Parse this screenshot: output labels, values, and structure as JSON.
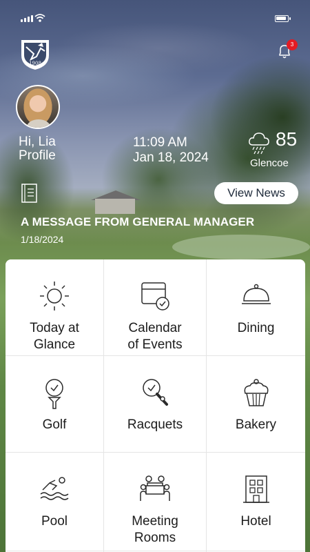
{
  "status_bar": {
    "signal_icon": "signal-icon",
    "wifi_icon": "wifi-icon",
    "battery_icon": "battery-icon"
  },
  "header": {
    "club_logo": {
      "year": "1908",
      "icon": "shield-logo-icon"
    },
    "notifications": {
      "icon": "bell-icon",
      "count": "3"
    }
  },
  "user": {
    "greeting": "Hi, Lia",
    "profile_link": "Profile"
  },
  "clock": {
    "time": "11:09 AM",
    "date": "Jan 18, 2024"
  },
  "weather": {
    "icon": "rain-cloud-icon",
    "temperature": "85",
    "location": "Glencoe"
  },
  "news": {
    "doc_icon": "document-icon",
    "button_label": "View News",
    "headline": "A MESSAGE FROM GENERAL MANAGER",
    "date": "1/18/2024"
  },
  "tiles": [
    {
      "line1": "Today at",
      "line2": "Glance",
      "icon": "sun-icon"
    },
    {
      "line1": "Calendar",
      "line2": "of Events",
      "icon": "calendar-check-icon"
    },
    {
      "line1": "Dining",
      "line2": "",
      "icon": "cloche-icon"
    },
    {
      "line1": "Golf",
      "line2": "",
      "icon": "golf-ball-tee-icon"
    },
    {
      "line1": "Racquets",
      "line2": "",
      "icon": "racquet-icon"
    },
    {
      "line1": "Bakery",
      "line2": "",
      "icon": "cupcake-icon"
    },
    {
      "line1": "Pool",
      "line2": "",
      "icon": "swimmer-icon"
    },
    {
      "line1": "Meeting",
      "line2": "Rooms",
      "icon": "meeting-icon"
    },
    {
      "line1": "Hotel",
      "line2": "",
      "icon": "hotel-icon"
    }
  ],
  "colors": {
    "accent_text": "#1e2a3a",
    "badge": "#e31b23",
    "tile_text": "#1c1c1c"
  }
}
